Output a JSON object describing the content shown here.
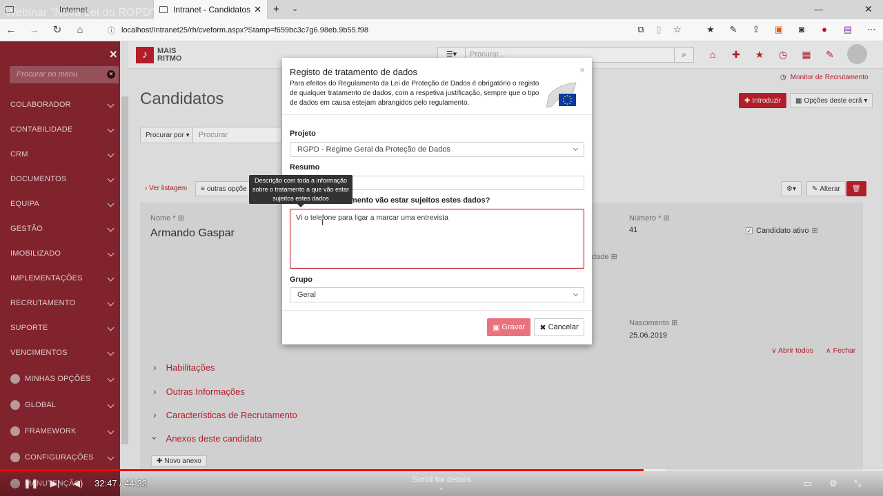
{
  "browser": {
    "video_title": "Webinar \"Nova Lei do RGPD\"",
    "inactive_tab": "Internet",
    "active_tab": "Intranet - Candidatos",
    "url": "localhost/Intranet25/rh/cveform.aspx?Stamp=f659bc3c7g6.98eb.9b55.f98"
  },
  "sidebar": {
    "search_placeholder": "Procurar no menu",
    "items": [
      "COLABORADOR",
      "CONTABILIDADE",
      "CRM",
      "DOCUMENTOS",
      "EQUIPA",
      "GESTÃO",
      "IMOBILIZADO",
      "IMPLEMENTAÇÕES",
      "RECRUTAMENTO",
      "SUPORTE",
      "VENCIMENTOS"
    ],
    "icon_items": [
      "MINHAS OPÇÕES",
      "GLOBAL",
      "FRAMEWORK",
      "CONFIGURAÇÕES",
      "MANUTENÇÃO"
    ]
  },
  "topbar": {
    "logo_line1": "MAIS",
    "logo_line2": "RITMO",
    "search_placeholder": "Procurar..."
  },
  "page": {
    "title": "Candidatos",
    "monitor_link": "Monitor de Recrutamento",
    "introduzir": "Introduzir",
    "opcoes": "Opções deste ecrã",
    "procurar_por": "Procurar por",
    "procurar_placeholder": "Procurar",
    "ver_listagem": "Ver listagem",
    "outras_opcoes": "outras opçõe",
    "alterar": "Alterar",
    "nome_label": "Nome *",
    "nome_value": "Armando Gaspar",
    "numero_label": "Número *",
    "numero_value": "41",
    "candidato_ativo": "Candidato ativo",
    "partial_label": "dade",
    "nascimento_label": "Nascimento",
    "nascimento_value": "25.06.2019",
    "abrir_todos": "Abrir todos",
    "fechar": "Fechar",
    "sections": [
      "Habilitações",
      "Outras Informações",
      "Características de Recrutamento",
      "Anexos deste candidato"
    ],
    "novo_anexo": "Novo anexo"
  },
  "modal": {
    "title": "Registo de tratamento de dados",
    "description": "Para efeitos do Regulamento da Lei de Proteção de Dados é obrigatório o registo de qualquer tratamento de dados, com a respetiva justificação, sempre que o tipo de dados em causa estejam abrangidos pelo regulamento.",
    "projeto_label": "Projeto",
    "projeto_value": "RGPD - Regime Geral da Proteção de Dados",
    "resumo_label": "Resumo",
    "question_label": "mento vão estar sujeitos estes dados?",
    "text_value": "Vi o telefone para ligar a marcar uma entrevista",
    "grupo_label": "Grupo",
    "grupo_value": "Geral",
    "gravar": "Gravar",
    "cancelar": "Cancelar",
    "tooltip": "Descrição com toda a informação sobre o tratamento a que vão estar sujeitos estes dados"
  },
  "video": {
    "time": "32:47 / 44:32",
    "scroll_hint": "Scroll for details",
    "progress_fraction": 0.729
  }
}
